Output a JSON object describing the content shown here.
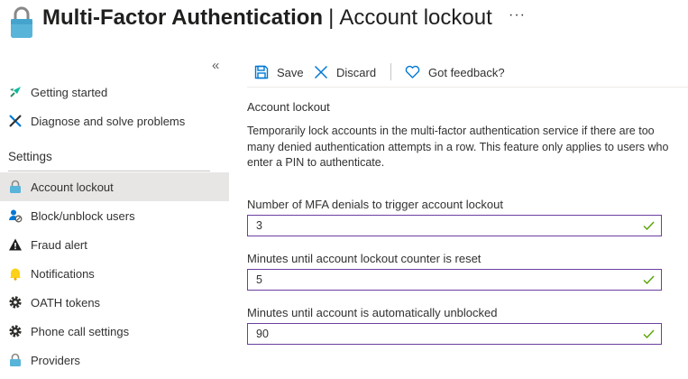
{
  "header": {
    "title_main": "Multi-Factor Authentication",
    "title_separator": "|",
    "title_sub": "Account lockout",
    "more_label": "···"
  },
  "sidebar": {
    "collapse_label": "«",
    "items": [
      {
        "label": "Getting started",
        "icon": "rocket-icon"
      },
      {
        "label": "Diagnose and solve problems",
        "icon": "wrench-icon"
      }
    ],
    "section_heading": "Settings",
    "settings_items": [
      {
        "label": "Account lockout",
        "icon": "lock-icon",
        "selected": true
      },
      {
        "label": "Block/unblock users",
        "icon": "user-block-icon"
      },
      {
        "label": "Fraud alert",
        "icon": "warning-icon"
      },
      {
        "label": "Notifications",
        "icon": "bell-icon"
      },
      {
        "label": "OATH tokens",
        "icon": "gear-icon"
      },
      {
        "label": "Phone call settings",
        "icon": "gear-icon"
      },
      {
        "label": "Providers",
        "icon": "lock-icon"
      }
    ]
  },
  "toolbar": {
    "save_label": "Save",
    "discard_label": "Discard",
    "feedback_label": "Got feedback?"
  },
  "content": {
    "title": "Account lockout",
    "description": "Temporarily lock accounts in the multi-factor authentication service if there are too many denied authentication attempts in a row. This feature only applies to users who enter a PIN to authenticate.",
    "fields": [
      {
        "label": "Number of MFA denials to trigger account lockout",
        "value": "3"
      },
      {
        "label": "Minutes until account lockout counter is reset",
        "value": "5"
      },
      {
        "label": "Minutes until account is automatically unblocked",
        "value": "90"
      }
    ]
  },
  "colors": {
    "accent": "#0078d4",
    "field_border": "#6b3fa0",
    "valid_check": "#57a300",
    "selected_bg": "#e8e6e5"
  }
}
